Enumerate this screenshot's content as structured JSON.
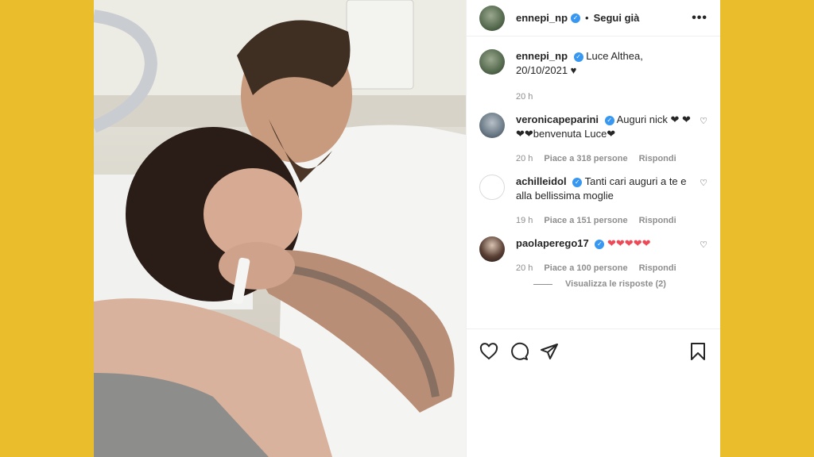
{
  "header": {
    "username": "ennepi_np",
    "separator": "•",
    "follow_label": "Segui già",
    "more_label": "•••"
  },
  "caption": {
    "username": "ennepi_np",
    "text": "Luce Althea, 20/10/2021 ♥",
    "time": "20 h"
  },
  "comments": [
    {
      "username": "veronicapeparini",
      "text": "Auguri nick ❤ ❤❤❤benvenuta Luce❤",
      "time": "20 h",
      "likes": "Piace a 318 persone",
      "reply": "Rispondi"
    },
    {
      "username": "achilleidol",
      "text": "Tanti cari auguri a te e alla bellissima moglie",
      "time": "19 h",
      "likes": "Piace a 151 persone",
      "reply": "Rispondi"
    },
    {
      "username": "paolaperego17",
      "text": "❤❤❤❤❤",
      "time": "20 h",
      "likes": "Piace a 100 persone",
      "reply": "Rispondi"
    }
  ],
  "view_replies": "Visualizza le risposte (2)",
  "icons": {
    "like": "heart-icon",
    "comment": "comment-icon",
    "share": "share-icon",
    "save": "bookmark-icon",
    "verified": "verified-badge-icon"
  },
  "colors": {
    "background": "#e9bd2b",
    "verified": "#3897f0",
    "heart": "#ed4956",
    "muted": "#8e8e8e"
  }
}
